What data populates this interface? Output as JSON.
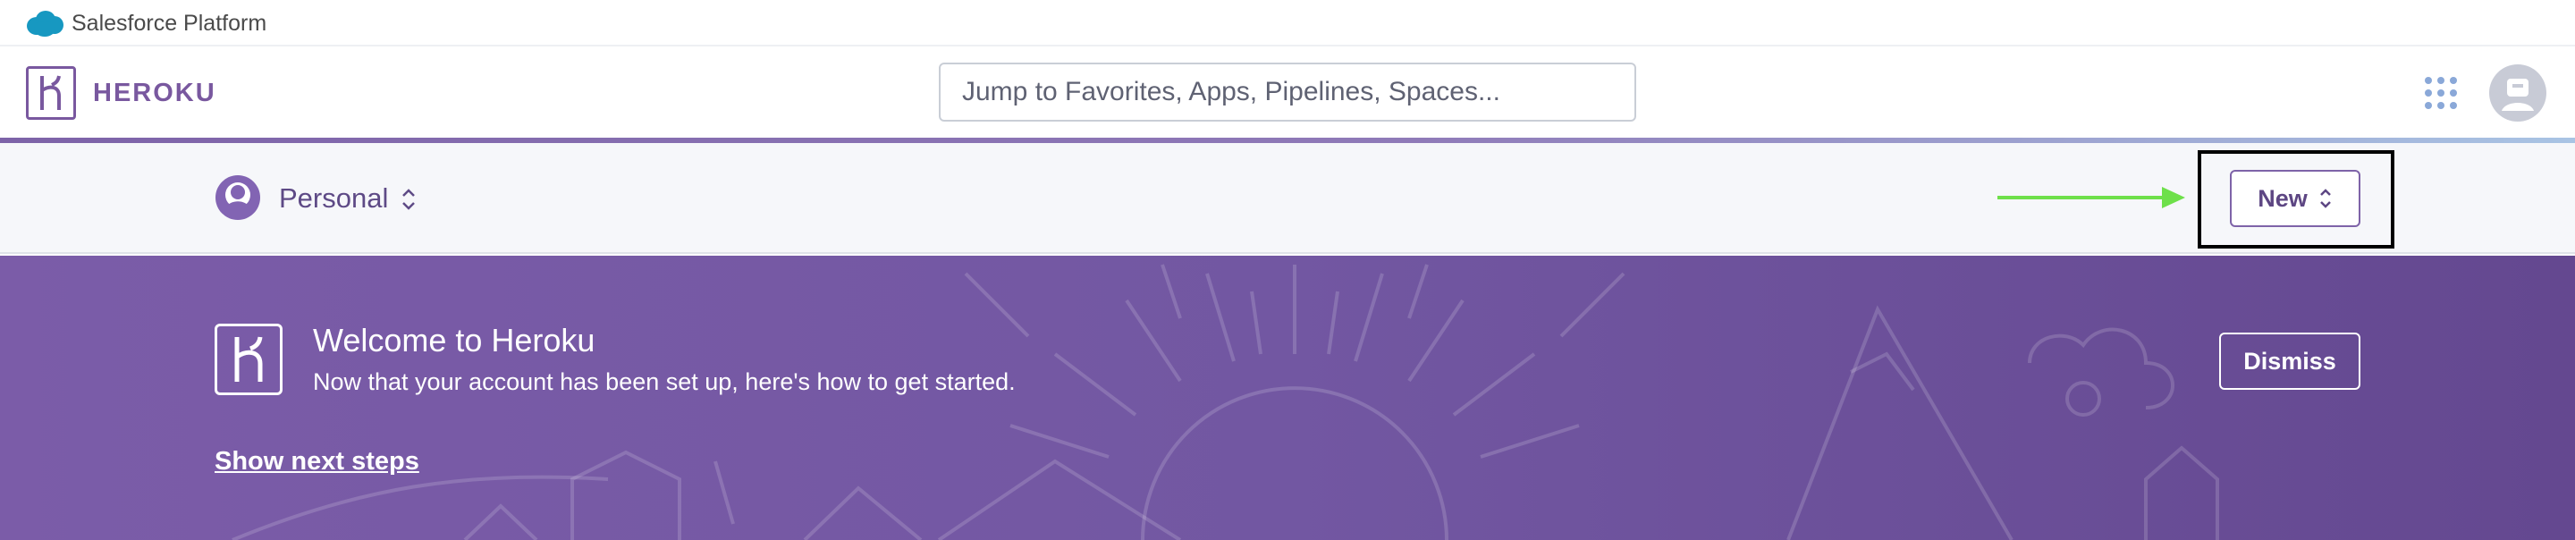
{
  "salesforce_bar": {
    "label": "Salesforce Platform",
    "icon": "salesforce-cloud-icon",
    "brand_color": "#1798c1"
  },
  "header": {
    "logo_icon": "heroku-logo-icon",
    "wordmark": "HEROKU",
    "search_placeholder": "Jump to Favorites, Apps, Pipelines, Spaces...",
    "apps_icon": "apps-grid-icon",
    "avatar_icon": "user-avatar-icon",
    "brand_color": "#79589f"
  },
  "context_bar": {
    "account_name": "Personal",
    "account_icon": "person-icon",
    "switcher_icon": "chevron-updown-icon",
    "new_button_label": "New",
    "annotation": {
      "arrow_color": "#6ee04a",
      "highlight_color": "#000000"
    }
  },
  "welcome": {
    "title": "Welcome to Heroku",
    "subtitle": "Now that your account has been set up, here's how to get started.",
    "link_label": "Show next steps",
    "dismiss_label": "Dismiss",
    "logo_icon": "heroku-logo-icon",
    "background_color": "#7257a2"
  }
}
